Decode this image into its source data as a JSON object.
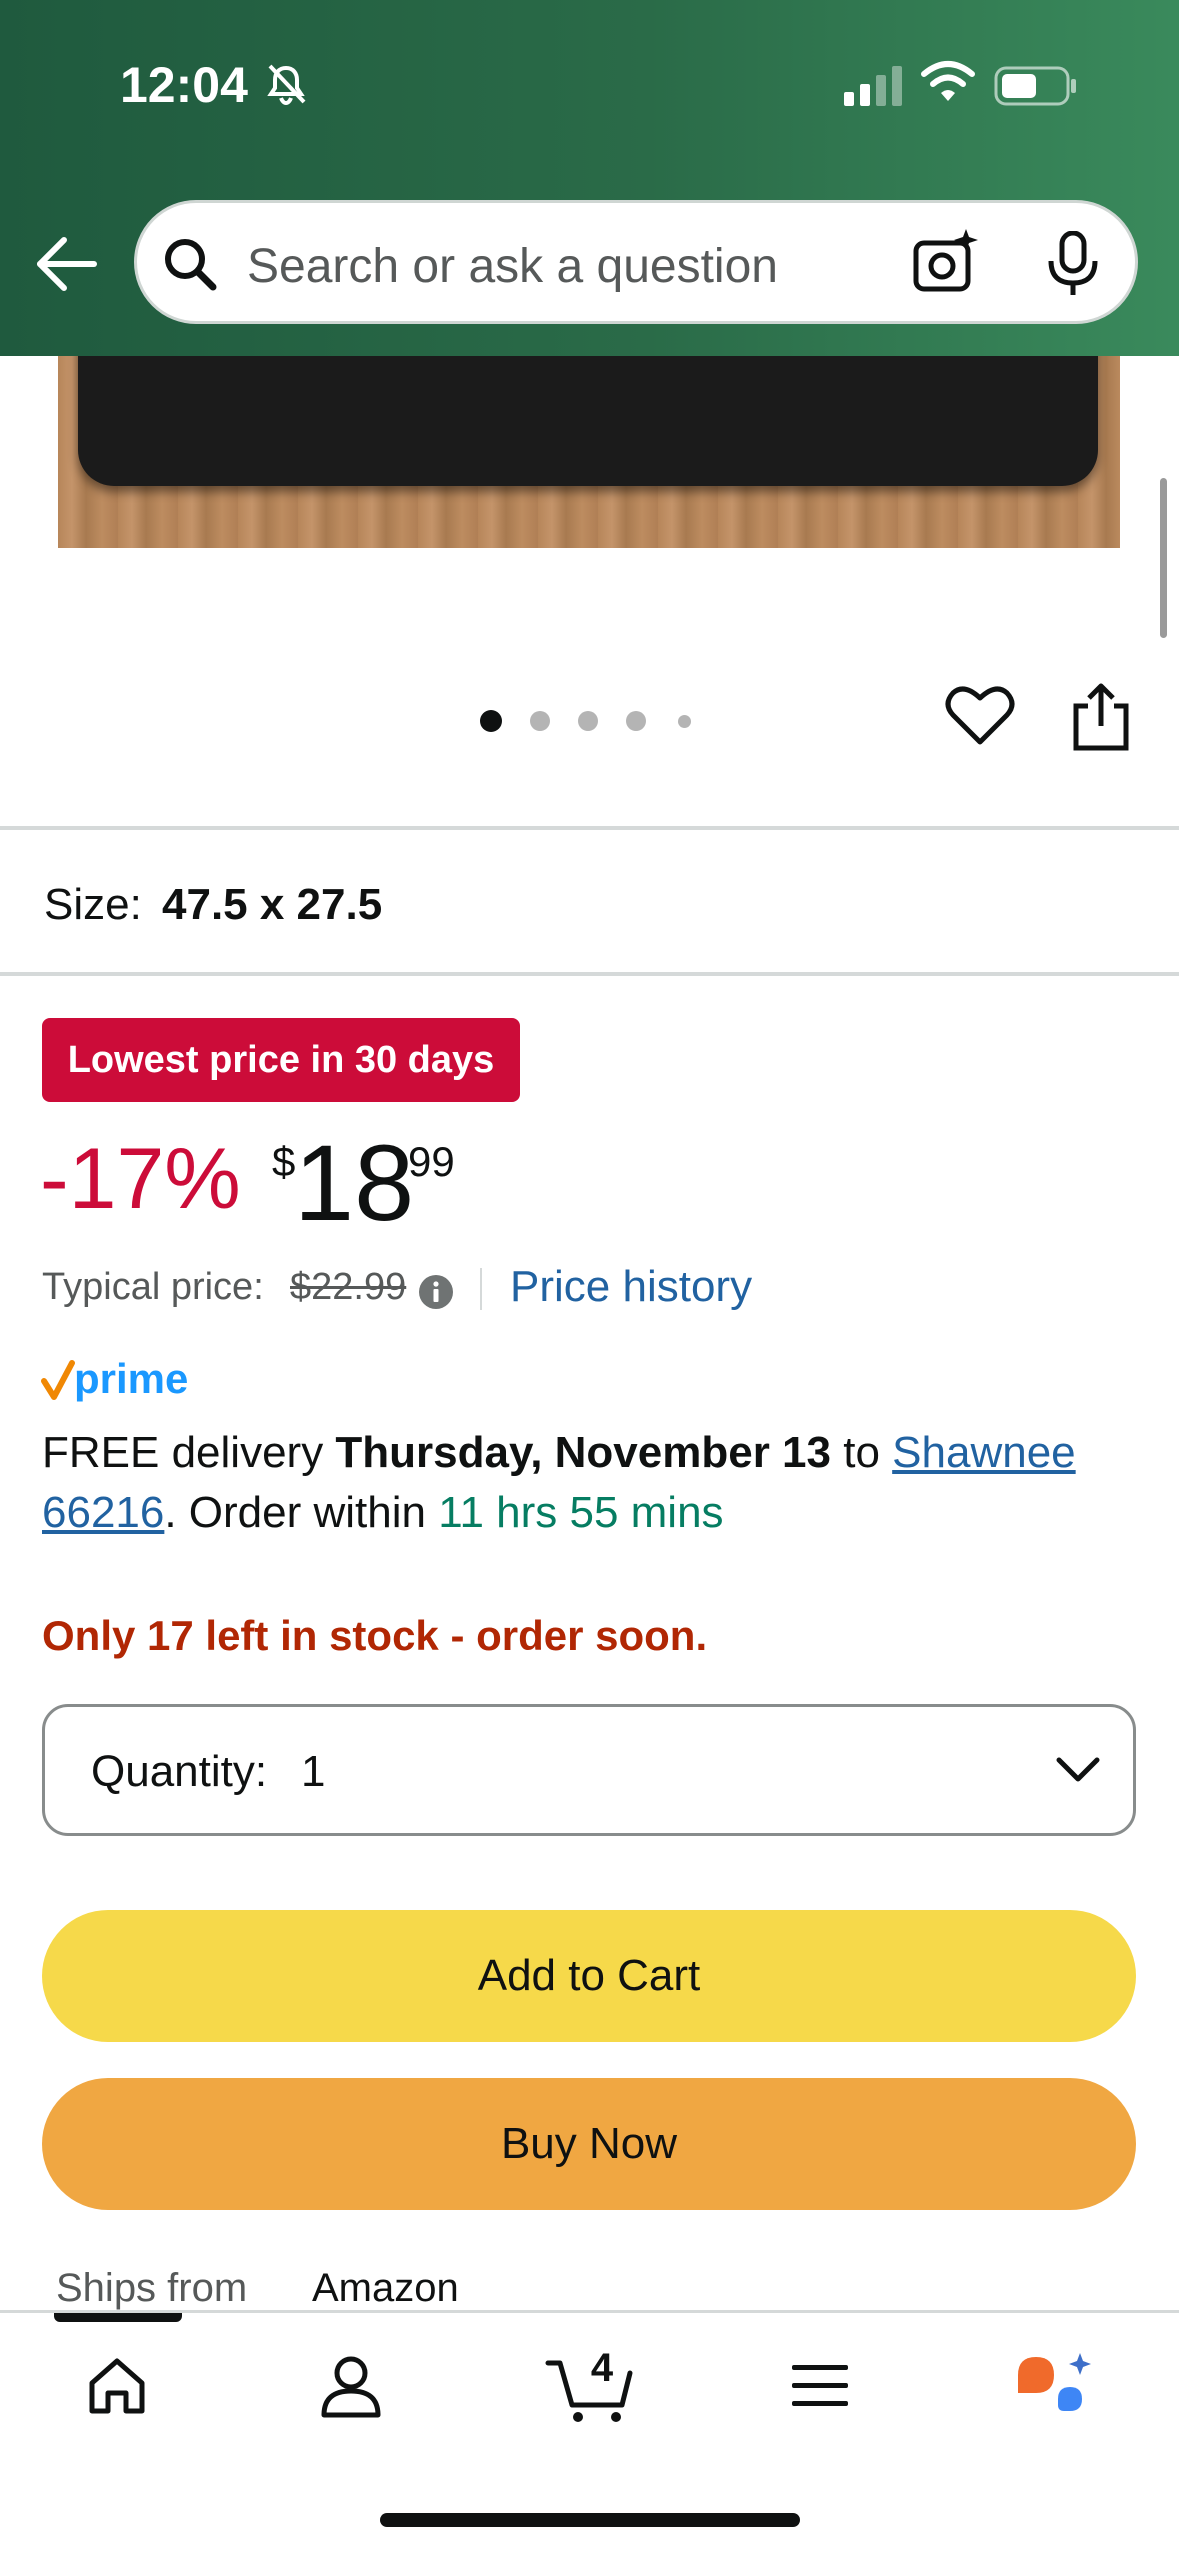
{
  "status_bar": {
    "time": "12:04"
  },
  "search": {
    "placeholder": "Search or ask a question"
  },
  "gallery": {
    "image_count": 5,
    "active_index": 0
  },
  "product": {
    "size_label": "Size:",
    "size_value": "47.5 x 27.5"
  },
  "pricing": {
    "deal_badge": "Lowest price in 30 days",
    "discount": "-17%",
    "currency_symbol": "$",
    "price_whole": "18",
    "price_fraction": "99",
    "typical_label": "Typical price:",
    "typical_value": "$22.99",
    "price_history_link": "Price history"
  },
  "delivery": {
    "prime_label": "prime",
    "line1_prefix": "FREE delivery ",
    "date": "Thursday, November 13",
    "to": " to ",
    "location_line1": "Shawnee",
    "location_line2": "66216",
    "order_within_prefix": ". Order within ",
    "countdown": "11 hrs 55 mins"
  },
  "stock": {
    "message": "Only 17 left in stock - order soon."
  },
  "quantity": {
    "label": "Quantity:",
    "value": "1"
  },
  "buttons": {
    "add_to_cart": "Add to Cart",
    "buy_now": "Buy Now"
  },
  "ships": {
    "label": "Ships from",
    "value": "Amazon"
  },
  "tabbar": {
    "cart_count": "4",
    "active_tab": "home"
  },
  "colors": {
    "header_green": "#2a6b48",
    "deal_red": "#cc0c39",
    "link_blue": "#2162a1",
    "add_to_cart": "#f6d94a",
    "buy_now": "#f0a742",
    "stock_red": "#b12704",
    "countdown_green": "#067d62"
  },
  "icons": [
    "back-arrow-icon",
    "search-icon",
    "camera-icon",
    "mic-icon",
    "heart-icon",
    "share-icon",
    "info-icon",
    "chevron-down-icon",
    "home-icon",
    "account-icon",
    "cart-icon",
    "menu-icon",
    "rufus-icon"
  ]
}
